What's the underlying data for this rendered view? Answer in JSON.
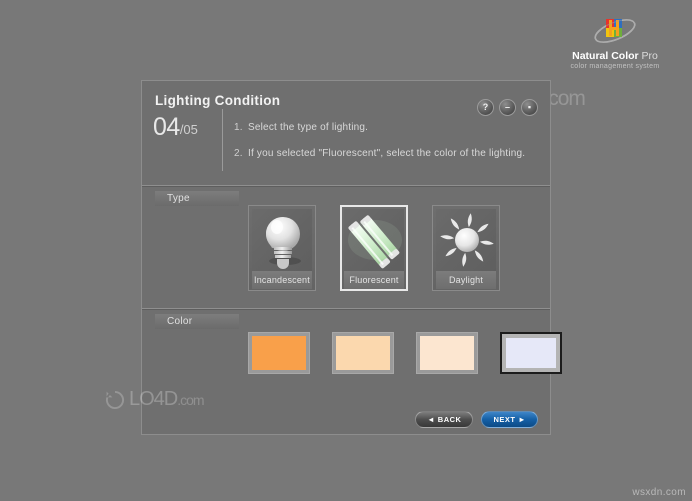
{
  "brand": {
    "name_bold": "Natural Color",
    "name_light": "Pro",
    "subtitle": "color management system",
    "logo_icon": "color-squares-planet-logo"
  },
  "header": {
    "title": "Lighting Condition",
    "step_current": "04",
    "step_total": "/05",
    "instructions": [
      {
        "num": "1.",
        "text": "Select the type of lighting."
      },
      {
        "num": "2.",
        "text": "If you selected \"Fluorescent\", select the color of the lighting."
      }
    ],
    "window_controls": [
      {
        "name": "help-button",
        "glyph": "?"
      },
      {
        "name": "minimize-button",
        "glyph": "–"
      },
      {
        "name": "close-button",
        "glyph": "▪"
      }
    ]
  },
  "type_section": {
    "label": "Type",
    "options": [
      {
        "label": "Incandescent",
        "icon": "lightbulb-icon",
        "selected": false
      },
      {
        "label": "Fluorescent",
        "icon": "fluorescent-tube-icon",
        "selected": true
      },
      {
        "label": "Daylight",
        "icon": "sun-icon",
        "selected": false
      }
    ]
  },
  "color_section": {
    "label": "Color",
    "swatches": [
      {
        "name": "swatch-warm-orange",
        "color": "#F9A04A",
        "selected": false
      },
      {
        "name": "swatch-light-peach",
        "color": "#FBD8AE",
        "selected": false
      },
      {
        "name": "swatch-pale-peach",
        "color": "#FCE6D0",
        "selected": false
      },
      {
        "name": "swatch-cool-white",
        "color": "#E6E8F8",
        "selected": true
      }
    ]
  },
  "navigation": {
    "back_label": "BACK",
    "next_label": "NEXT",
    "back_arrow": "◄",
    "next_arrow": "►"
  },
  "watermarks": {
    "site": "LO4D",
    "site_suffix": ".com",
    "corner_url": "wsxdn.com"
  },
  "colors": {
    "panel_bg": "#6f6f6f",
    "page_bg": "#787878",
    "accent_blue": "#1560A6",
    "selection_border": "#E8E8E8"
  }
}
